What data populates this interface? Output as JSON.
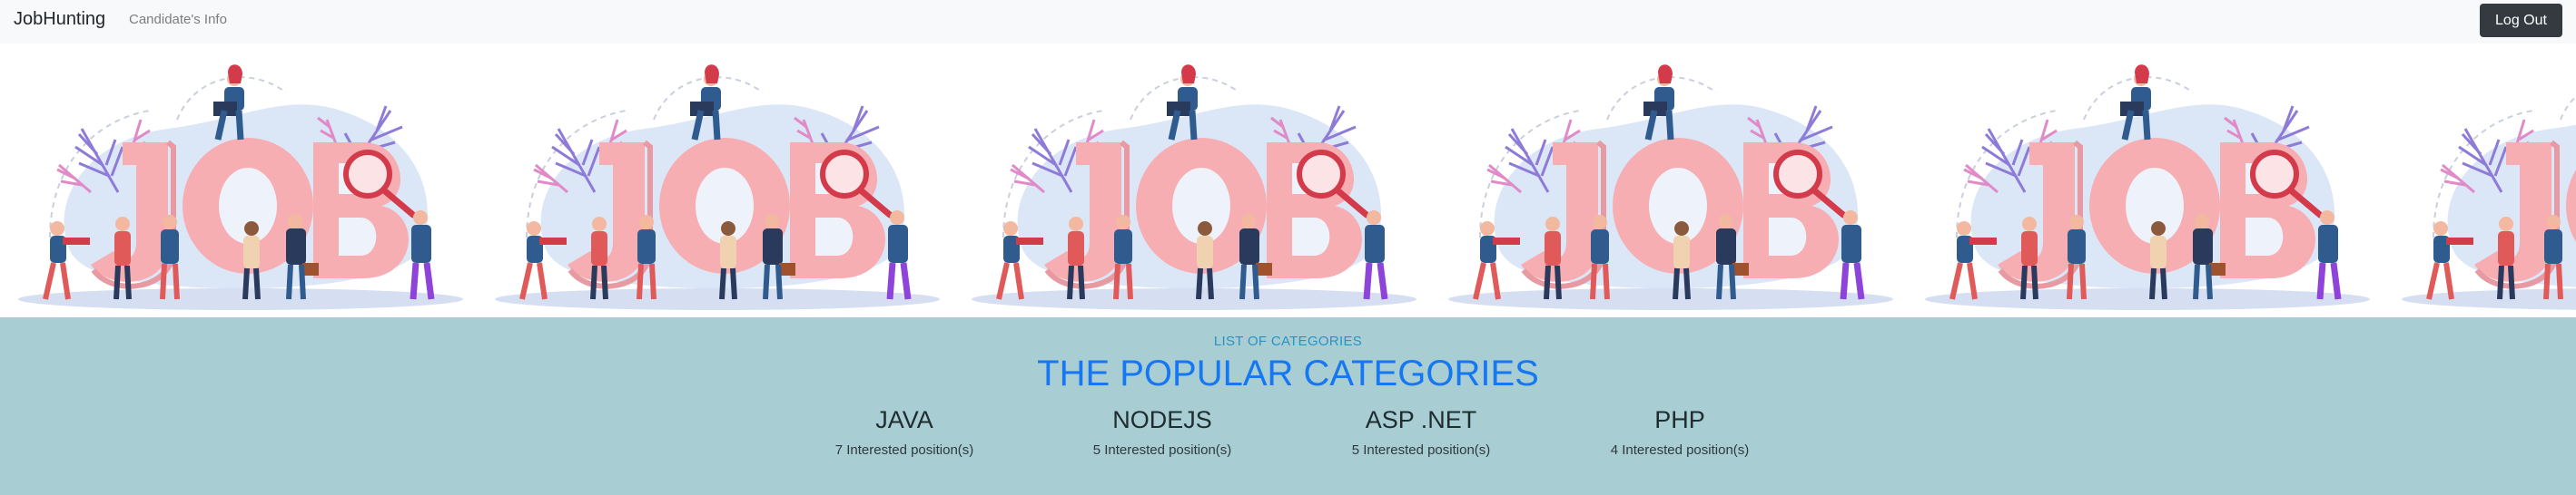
{
  "navbar": {
    "brand": "JobHunting",
    "links": [
      {
        "label": "Candidate's Info"
      }
    ],
    "logout_label": "Log Out",
    "background": "#f8f9fa"
  },
  "banner": {
    "illustration": "job-hiring-illustration",
    "word": "JOB",
    "colors": {
      "letters": "#f6aeb3",
      "leaves_purple": "#8e7bd8",
      "leaves_pink": "#e08ac7",
      "blob": "#dbe6f7",
      "magnifier": "#d33a4a"
    }
  },
  "categories": {
    "eyebrow": "LIST OF CATEGORIES",
    "title": "THE POPULAR CATEGORIES",
    "background": "#a8cdd3",
    "items": [
      {
        "name": "JAVA",
        "count": "7 Interested position(s)"
      },
      {
        "name": "NODEJS",
        "count": "5 Interested position(s)"
      },
      {
        "name": "ASP .NET",
        "count": "5 Interested position(s)"
      },
      {
        "name": "PHP",
        "count": "4 Interested position(s)"
      }
    ]
  }
}
